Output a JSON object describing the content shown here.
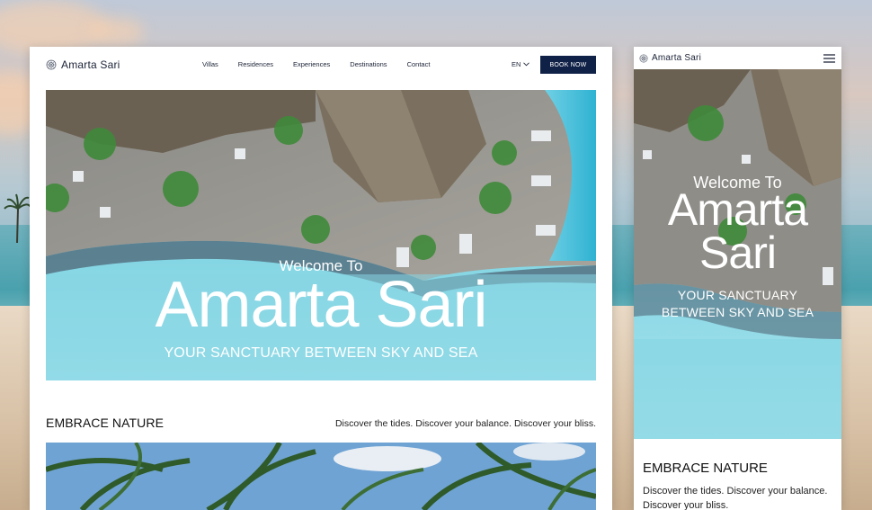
{
  "brand": {
    "name": "Amarta Sari"
  },
  "nav": {
    "items": [
      "Villas",
      "Residences",
      "Experiences",
      "Destinations",
      "Contact"
    ],
    "language": "EN",
    "book_label": "BOOK NOW"
  },
  "hero": {
    "welcome": "Welcome To",
    "title": "Amarta Sari",
    "title_line1": "Amarta",
    "title_line2": "Sari",
    "subtitle": "YOUR SANCTUARY BETWEEN SKY AND SEA",
    "subtitle_line1": "YOUR SANCTUARY",
    "subtitle_line2": "BETWEEN SKY AND SEA"
  },
  "section": {
    "title": "EMBRACE NATURE",
    "tagline": "Discover the tides. Discover your balance. Discover your bliss."
  },
  "colors": {
    "navy": "#0f2147",
    "text": "#1b2236",
    "sea": "#4fc3d8"
  },
  "icons": [
    "logo-mark-icon",
    "chevron-down-icon",
    "hamburger-menu-icon"
  ]
}
